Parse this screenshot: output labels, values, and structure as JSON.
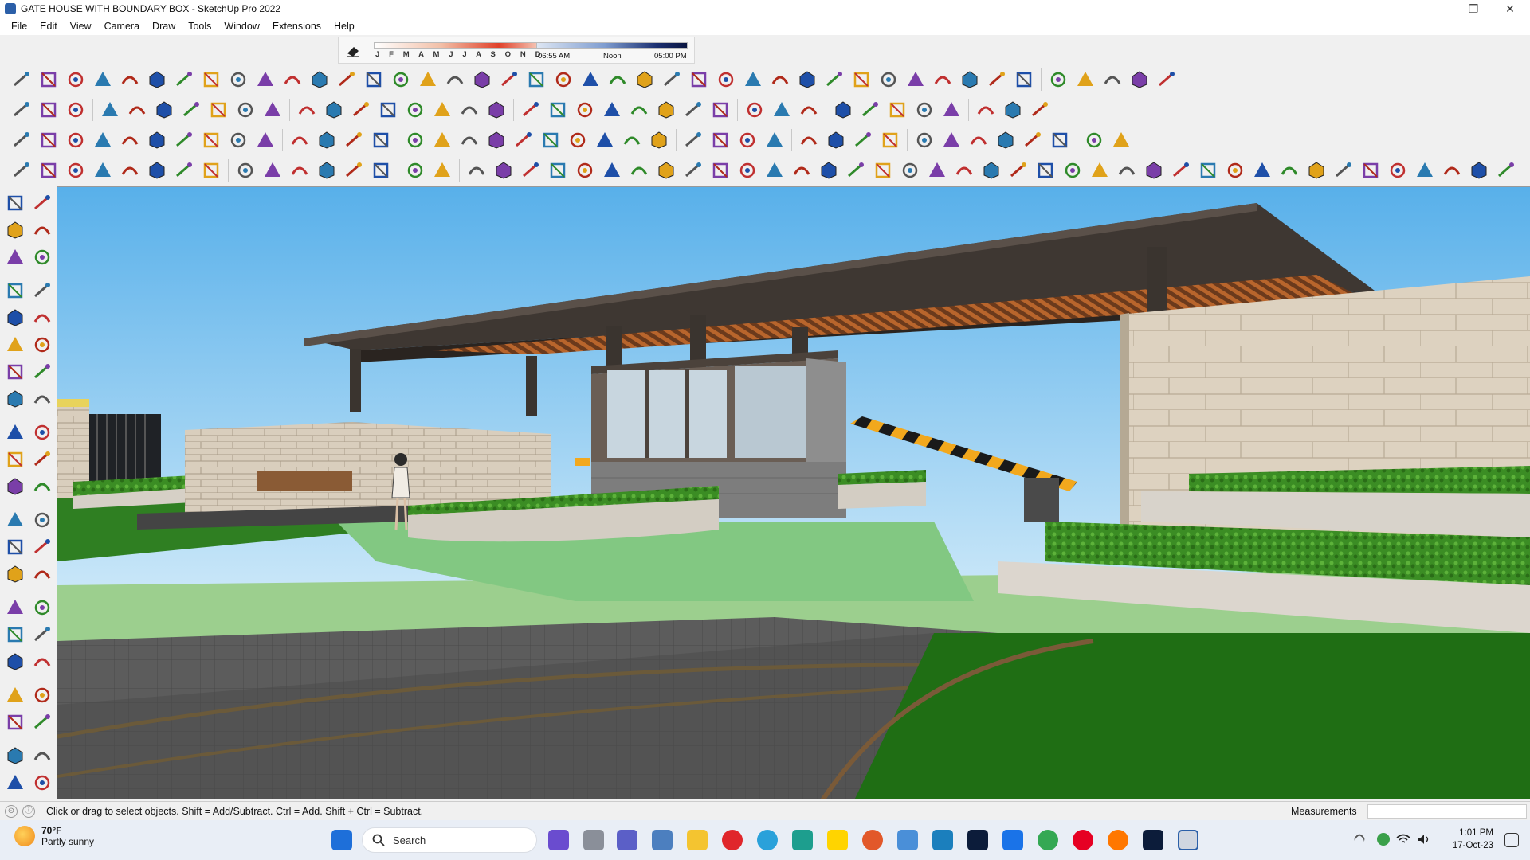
{
  "window": {
    "title": "GATE HOUSE WITH BOUNDARY BOX - SketchUp Pro 2022"
  },
  "window_controls": {
    "minimize": "—",
    "maximize": "❐",
    "close": "✕"
  },
  "menu": [
    "File",
    "Edit",
    "View",
    "Camera",
    "Draw",
    "Tools",
    "Window",
    "Extensions",
    "Help"
  ],
  "shadows": {
    "months": "J F M A M J J A S O N D",
    "time_start": "06:55 AM",
    "time_mid": "Noon",
    "time_end": "05:00 PM"
  },
  "status": {
    "message": "Click or drag to select objects. Shift = Add/Subtract. Ctrl = Add. Shift + Ctrl = Subtract.",
    "measurements_label": "Measurements",
    "measurements_value": ""
  },
  "taskbar": {
    "weather_temp": "70°F",
    "weather_desc": "Partly sunny",
    "search_label": "Search",
    "time": "1:01 PM",
    "date": "17-Oct-23"
  },
  "colors": {
    "accent": "#2b5fa8",
    "sky_top": "#5fb6ee",
    "sky_bottom": "#c2e3f7",
    "grass": "#2f7f22",
    "road": "#5a5a5a",
    "stone": "#d8cdbc"
  },
  "toolbar_rows": [
    {
      "name": "row1",
      "icons": [
        "followme-icon",
        "line-tool-icon",
        "arc-icon",
        "offset-icon",
        "spiral-icon",
        "spline-icon",
        "rope-icon",
        "curve-icon",
        "path-icon",
        "sweep-icon",
        "bend-icon",
        "corner-icon",
        "slice-icon",
        "joint-icon",
        "clip-icon",
        "stairs-icon",
        "roof-icon",
        "ramp-icon",
        "gear-icon",
        "spring-icon",
        "wave-icon",
        "drape-icon",
        "mesh-icon",
        "slat-icon",
        "flat-icon",
        "twist-icon",
        "warp-icon",
        "helix-icon",
        "bezier-icon",
        "loft-icon",
        "extrude-icon",
        "surface-icon",
        "shell-icon",
        "grid-icon",
        "bars-icon",
        "deco-icon",
        "sphere-icon",
        "hole-icon",
        "box-icon",
        "house-icon",
        "shop-icon",
        "barn-icon",
        "garage-icon"
      ]
    }
  ]
}
